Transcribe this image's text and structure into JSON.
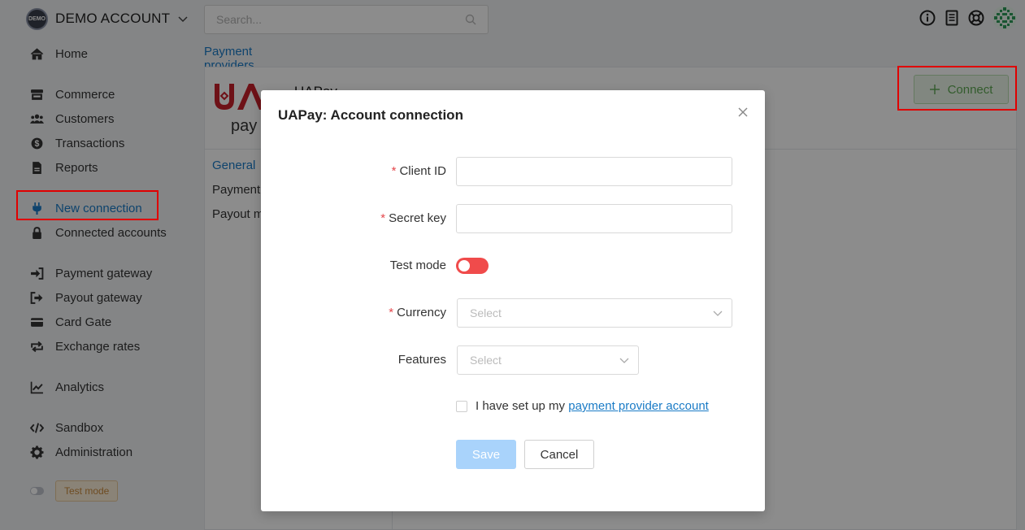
{
  "account": {
    "name": "DEMO ACCOUNT",
    "logo_text": "DEMO"
  },
  "search": {
    "placeholder": "Search..."
  },
  "sidebar": {
    "items": [
      {
        "label": "Home",
        "icon": "home-icon"
      },
      {
        "label": "Commerce",
        "icon": "store-icon"
      },
      {
        "label": "Customers",
        "icon": "users-icon"
      },
      {
        "label": "Transactions",
        "icon": "dollar-icon"
      },
      {
        "label": "Reports",
        "icon": "report-icon"
      },
      {
        "label": "New connection",
        "icon": "plug-icon"
      },
      {
        "label": "Connected accounts",
        "icon": "lock-icon"
      },
      {
        "label": "Payment gateway",
        "icon": "sign-in-icon"
      },
      {
        "label": "Payout gateway",
        "icon": "sign-out-icon"
      },
      {
        "label": "Card Gate",
        "icon": "card-icon"
      },
      {
        "label": "Exchange rates",
        "icon": "exchange-icon"
      },
      {
        "label": "Analytics",
        "icon": "chart-line-icon"
      },
      {
        "label": "Sandbox",
        "icon": "code-icon"
      },
      {
        "label": "Administration",
        "icon": "gear-icon"
      }
    ],
    "test_mode_label": "Test mode"
  },
  "tabs": {
    "payment_providers": "Payment providers"
  },
  "provider": {
    "name": "UAPay",
    "logo_text": "pay",
    "sub_nav": [
      "General",
      "Payment",
      "Payout m"
    ],
    "connect_label": "Connect"
  },
  "modal": {
    "title": "UAPay: Account connection",
    "fields": {
      "client_id": "Client ID",
      "secret_key": "Secret key",
      "test_mode": "Test mode",
      "currency": "Currency",
      "features": "Features"
    },
    "select_placeholder": "Select",
    "agree_text": "I have set up my ",
    "agree_link": "payment provider account",
    "save": "Save",
    "cancel": "Cancel"
  },
  "colors": {
    "accent": "#1a7bc6",
    "highlight": "#e00000",
    "toggle_off": "#f04b4b",
    "connect_green": "#5ea852",
    "save_disabled": "#a9d3fb"
  }
}
